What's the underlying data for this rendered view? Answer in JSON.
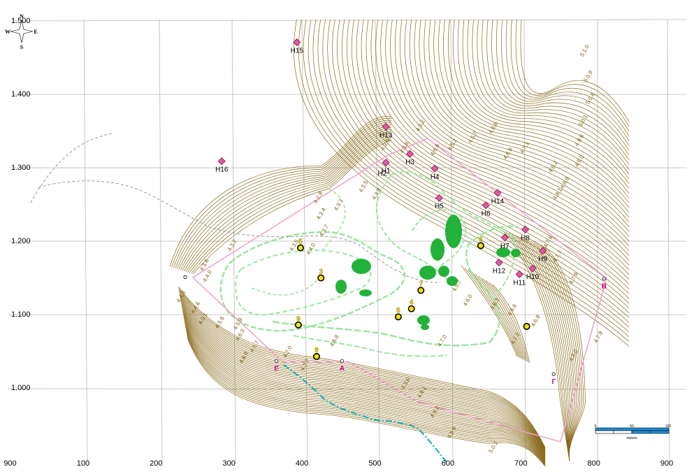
{
  "x_ticks": [
    {
      "value": 0,
      "label": "900"
    },
    {
      "value": 100,
      "label": "100"
    },
    {
      "value": 200,
      "label": "200"
    },
    {
      "value": 300,
      "label": "300"
    },
    {
      "value": 400,
      "label": "400"
    },
    {
      "value": 500,
      "label": "500"
    },
    {
      "value": 600,
      "label": "600"
    },
    {
      "value": 700,
      "label": "700"
    },
    {
      "value": 800,
      "label": "800"
    },
    {
      "value": 900,
      "label": "900"
    }
  ],
  "y_ticks": [
    {
      "value": 1500,
      "label": "1.500"
    },
    {
      "value": 1400,
      "label": "1.400"
    },
    {
      "value": 1300,
      "label": "1.300"
    },
    {
      "value": 1200,
      "label": "1.200"
    },
    {
      "value": 1100,
      "label": "1.100"
    },
    {
      "value": 1000,
      "label": "1.000"
    }
  ],
  "compass": {
    "n": "N",
    "s": "S",
    "e": "E",
    "w": "W"
  },
  "colors": {
    "contour": "#8a6a1a",
    "pit_zone": "#9be6a0",
    "pit_fill": "#22b23a",
    "boundary": "#f2a0c8",
    "marker": "#e05a9a",
    "stream": "#1fb0b0"
  },
  "markers": [
    {
      "label": "H15",
      "x": 393,
      "y": 1470
    },
    {
      "label": "H16",
      "x": 290,
      "y": 1308
    },
    {
      "label": "H13",
      "x": 515,
      "y": 1355
    },
    {
      "label": "H3",
      "x": 548,
      "y": 1318
    },
    {
      "label": "H1",
      "x": 515,
      "y": 1306
    },
    {
      "label": "H4",
      "x": 582,
      "y": 1298
    },
    {
      "label": "H5",
      "x": 588,
      "y": 1258
    },
    {
      "label": "H14",
      "x": 668,
      "y": 1265
    },
    {
      "label": "H6",
      "x": 652,
      "y": 1248
    },
    {
      "label": "H8",
      "x": 706,
      "y": 1215
    },
    {
      "label": "H7",
      "x": 678,
      "y": 1204
    },
    {
      "label": "H9",
      "x": 730,
      "y": 1186
    },
    {
      "label": "H12",
      "x": 670,
      "y": 1170
    },
    {
      "label": "H10",
      "x": 716,
      "y": 1162
    },
    {
      "label": "H11",
      "x": 698,
      "y": 1154
    }
  ],
  "extra_labels": [
    {
      "label": "H2",
      "x": 510,
      "y": 1288
    }
  ],
  "wells": [
    {
      "label": "3",
      "x": 426,
      "y": 1149
    },
    {
      "label": "5",
      "x": 398,
      "y": 1190
    },
    {
      "label": "7",
      "x": 563,
      "y": 1132
    },
    {
      "label": "4",
      "x": 550,
      "y": 1107
    },
    {
      "label": "5",
      "x": 532,
      "y": 1096
    },
    {
      "label": "9",
      "x": 395,
      "y": 1085
    },
    {
      "label": "8",
      "x": 420,
      "y": 1042
    },
    {
      "label": "6",
      "x": 645,
      "y": 1193
    },
    {
      "label": "",
      "x": 708,
      "y": 1083
    }
  ],
  "points": [
    {
      "label": "B",
      "x": 814,
      "y": 1148
    },
    {
      "label": "Г",
      "x": 745,
      "y": 1018
    },
    {
      "label": "E",
      "x": 365,
      "y": 1036
    },
    {
      "label": "A",
      "x": 455,
      "y": 1036
    },
    {
      "label": "",
      "x": 240,
      "y": 1150
    }
  ],
  "contour_labels": [
    {
      "text": "5.1.0",
      "x": 785,
      "y": 1450
    },
    {
      "text": "5.0.9",
      "x": 790,
      "y": 1415
    },
    {
      "text": "5.0.8",
      "x": 793,
      "y": 1385
    },
    {
      "text": "5.0.1",
      "x": 783,
      "y": 1355
    },
    {
      "text": "4.9.8",
      "x": 778,
      "y": 1328
    },
    {
      "text": "4.9.0",
      "x": 778,
      "y": 1300
    },
    {
      "text": "4.8.9",
      "x": 758,
      "y": 1270
    },
    {
      "text": "4.8.2",
      "x": 742,
      "y": 1292
    },
    {
      "text": "4.8.1",
      "x": 748,
      "y": 1255
    },
    {
      "text": "4.7.1",
      "x": 703,
      "y": 1318
    },
    {
      "text": "4.6.9",
      "x": 680,
      "y": 1310
    },
    {
      "text": "4.6.8",
      "x": 660,
      "y": 1345
    },
    {
      "text": "4.5.7",
      "x": 632,
      "y": 1332
    },
    {
      "text": "4.5.2",
      "x": 604,
      "y": 1322
    },
    {
      "text": "4.6.8",
      "x": 580,
      "y": 1315
    },
    {
      "text": "4.3.2",
      "x": 560,
      "y": 1348
    },
    {
      "text": "4.3.8",
      "x": 538,
      "y": 1318
    },
    {
      "text": "4.3.5",
      "x": 512,
      "y": 1322
    },
    {
      "text": "4.3.5",
      "x": 482,
      "y": 1265
    },
    {
      "text": "4.3.8",
      "x": 500,
      "y": 1255
    },
    {
      "text": "4.2.9",
      "x": 420,
      "y": 1250
    },
    {
      "text": "4.3.7",
      "x": 448,
      "y": 1240
    },
    {
      "text": "4.3.4",
      "x": 424,
      "y": 1228
    },
    {
      "text": "4.3.7",
      "x": 428,
      "y": 1205
    },
    {
      "text": "4.3.2",
      "x": 302,
      "y": 1185
    },
    {
      "text": "4.3.5",
      "x": 387,
      "y": 1185
    },
    {
      "text": "4.4.0",
      "x": 410,
      "y": 1180
    },
    {
      "text": "4.3.6",
      "x": 264,
      "y": 1158
    },
    {
      "text": "4.4.0",
      "x": 268,
      "y": 1143
    },
    {
      "text": "4.4.3",
      "x": 232,
      "y": 1115
    },
    {
      "text": "4.4.6",
      "x": 252,
      "y": 1100
    },
    {
      "text": "4.5.1",
      "x": 262,
      "y": 1085
    },
    {
      "text": "4.5.6",
      "x": 285,
      "y": 1080
    },
    {
      "text": "4.5.9",
      "x": 310,
      "y": 1078
    },
    {
      "text": "4.6.3",
      "x": 313,
      "y": 1063
    },
    {
      "text": "4.6.7",
      "x": 333,
      "y": 1047
    },
    {
      "text": "4.6.8",
      "x": 318,
      "y": 1032
    },
    {
      "text": "4.7.0",
      "x": 378,
      "y": 1040
    },
    {
      "text": "4.7.7",
      "x": 402,
      "y": 1022
    },
    {
      "text": "4.6.8",
      "x": 442,
      "y": 1055
    },
    {
      "text": "4.9.0",
      "x": 540,
      "y": 997
    },
    {
      "text": "4.9.1",
      "x": 562,
      "y": 985
    },
    {
      "text": "4.9.2",
      "x": 580,
      "y": 958
    },
    {
      "text": "4.9.6",
      "x": 603,
      "y": 930
    },
    {
      "text": "5.0.1",
      "x": 660,
      "y": 910
    },
    {
      "text": "4.7.0",
      "x": 590,
      "y": 1055
    },
    {
      "text": "4.5.7",
      "x": 610,
      "y": 1130
    },
    {
      "text": "4.6.0",
      "x": 625,
      "y": 1110
    },
    {
      "text": "4.6.3",
      "x": 662,
      "y": 1105
    },
    {
      "text": "4.6.6",
      "x": 686,
      "y": 1097
    },
    {
      "text": "4.6.9",
      "x": 718,
      "y": 1082
    },
    {
      "text": "4.7.2",
      "x": 690,
      "y": 1058
    },
    {
      "text": "4.7.8",
      "x": 735,
      "y": 1190
    },
    {
      "text": "4.7.7",
      "x": 748,
      "y": 1170
    },
    {
      "text": "4.7.9",
      "x": 770,
      "y": 1140
    },
    {
      "text": "4.8.0",
      "x": 770,
      "y": 1035
    },
    {
      "text": "4.7.9",
      "x": 804,
      "y": 1060
    }
  ],
  "scalebar": {
    "labels": [
      "0",
      "50",
      "100"
    ],
    "unit": "meters"
  }
}
